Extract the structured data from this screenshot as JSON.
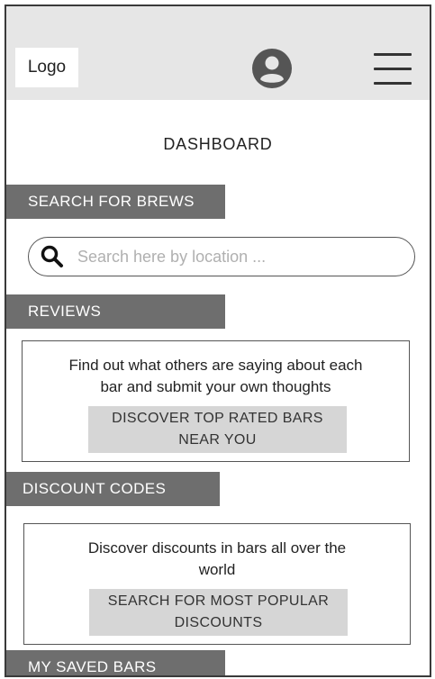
{
  "header": {
    "logo_label": "Logo",
    "avatar_icon": "user-circle-icon",
    "menu_icon": "hamburger-menu-icon"
  },
  "page": {
    "title": "DASHBOARD"
  },
  "search_section": {
    "header": "SEARCH FOR BREWS",
    "placeholder": "Search here by location ...",
    "value": "",
    "icon": "search-icon"
  },
  "reviews": {
    "header": "REVIEWS",
    "description_line1": "Find out what others are saying about each",
    "description_line2": "bar and submit your own thoughts",
    "button_line1": "DISCOVER TOP RATED BARS",
    "button_line2": "NEAR YOU"
  },
  "discounts": {
    "header": "DISCOUNT CODES",
    "description_line1": "Discover discounts in bars all over the",
    "description_line2": "world",
    "button_line1": "SEARCH FOR MOST POPULAR",
    "button_line2": "DISCOUNTS"
  },
  "saved_bars": {
    "header": "MY SAVED BARS"
  },
  "colors": {
    "topbar": "#e6e6e6",
    "section_header": "#6e6e6e",
    "button": "#d6d6d6"
  }
}
